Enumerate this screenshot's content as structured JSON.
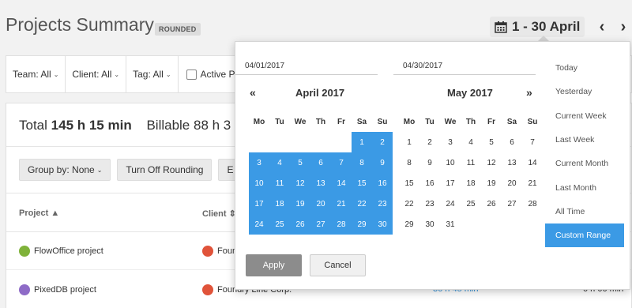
{
  "header": {
    "title": "Projects Summary",
    "badge": "ROUNDED",
    "date_range": "1 - 30 April",
    "prev_arrow": "‹",
    "next_arrow": "›"
  },
  "filters": {
    "team": "Team: All",
    "client": "Client: All",
    "tag": "Tag: All",
    "active_label": "Active P"
  },
  "report": {
    "total_label": "Total",
    "total_value": "145 h 15 min",
    "billable_text": "Billable 88 h 3",
    "buttons": {
      "group_by": "Group by: None",
      "rounding": "Turn Off Rounding",
      "partial": "E"
    },
    "columns": {
      "project": "Project",
      "client": "Client"
    },
    "rows": [
      {
        "project": "FlowOffice project",
        "client": "Foun",
        "project_color": "#7fb23a",
        "client_color": "#e0533a"
      },
      {
        "project": "PixedDB project",
        "client": "Foundry Line Corp.",
        "duration": "36 h 45 min",
        "amount": "0 h 00 min",
        "project_color": "#8e6bc7",
        "client_color": "#e0533a"
      }
    ]
  },
  "picker": {
    "start_date": "04/01/2017",
    "end_date": "04/30/2017",
    "prev_nav": "«",
    "next_nav": "»",
    "weekdays": [
      "Mo",
      "Tu",
      "We",
      "Th",
      "Fr",
      "Sa",
      "Su"
    ],
    "months": [
      {
        "title": "April 2017",
        "weeks": [
          [
            "",
            "",
            "",
            "",
            "",
            "1",
            "2"
          ],
          [
            "3",
            "4",
            "5",
            "6",
            "7",
            "8",
            "9"
          ],
          [
            "10",
            "11",
            "12",
            "13",
            "14",
            "15",
            "16"
          ],
          [
            "17",
            "18",
            "19",
            "20",
            "21",
            "22",
            "23"
          ],
          [
            "24",
            "25",
            "26",
            "27",
            "28",
            "29",
            "30"
          ]
        ],
        "selected_from": 1,
        "selected_to": 30
      },
      {
        "title": "May 2017",
        "weeks": [
          [
            "1",
            "2",
            "3",
            "4",
            "5",
            "6",
            "7"
          ],
          [
            "8",
            "9",
            "10",
            "11",
            "12",
            "13",
            "14"
          ],
          [
            "15",
            "16",
            "17",
            "18",
            "19",
            "20",
            "21"
          ],
          [
            "22",
            "23",
            "24",
            "25",
            "26",
            "27",
            "28"
          ],
          [
            "29",
            "30",
            "31",
            "",
            "",
            "",
            ""
          ]
        ],
        "selected_from": null,
        "selected_to": null
      }
    ],
    "presets": [
      "Today",
      "Yesterday",
      "Current Week",
      "Last Week",
      "Current Month",
      "Last Month",
      "All Time",
      "Custom Range"
    ],
    "active_preset": "Custom Range",
    "apply_label": "Apply",
    "cancel_label": "Cancel"
  },
  "colors": {
    "selection": "#3b9ae5",
    "link": "#2d8fd8"
  }
}
